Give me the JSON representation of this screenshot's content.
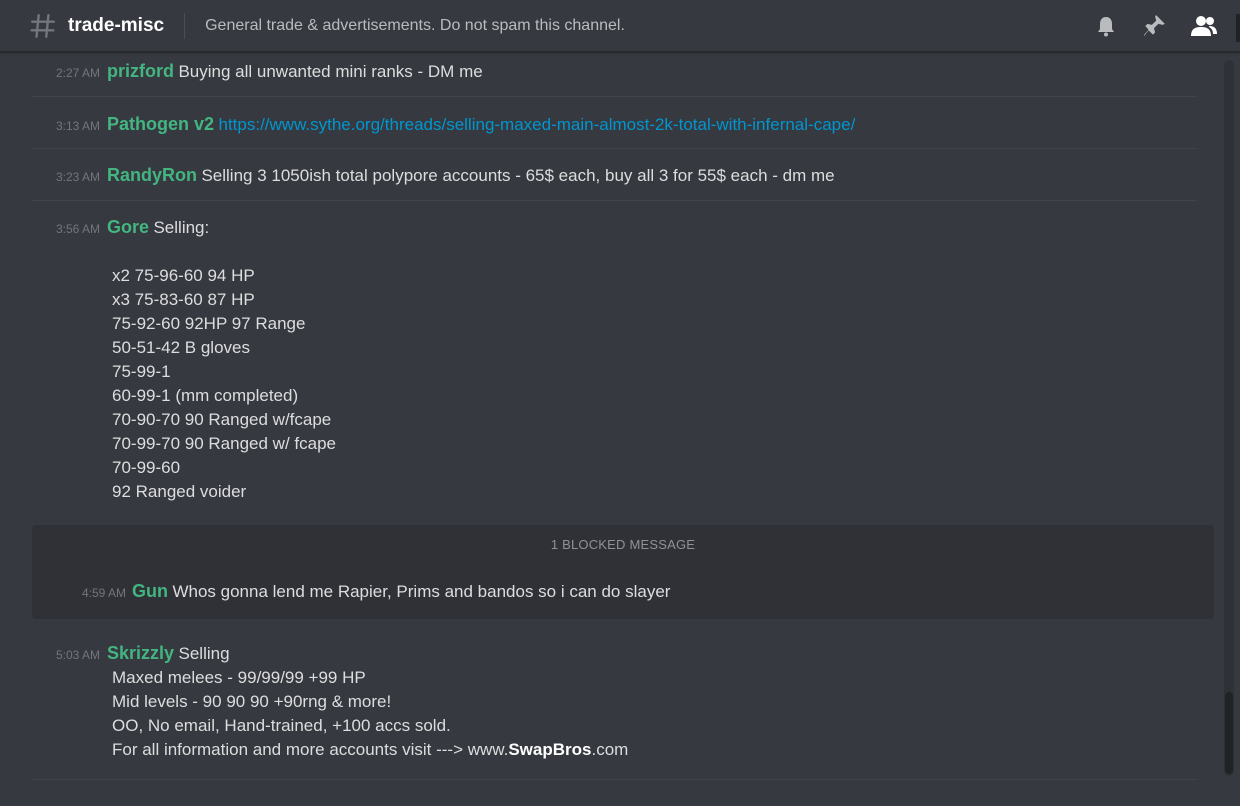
{
  "header": {
    "channel_name": "trade-misc",
    "topic": "General trade & advertisements. Do not spam this channel.",
    "icons": [
      "bell-icon",
      "pin-icon",
      "members-icon"
    ]
  },
  "messages": [
    {
      "time": "2:27 AM",
      "author": "prizford",
      "text": "Buying all unwanted mini ranks - DM me"
    },
    {
      "time": "3:13 AM",
      "author": "Pathogen v2",
      "link": "https://www.sythe.org/threads/selling-maxed-main-almost-2k-total-with-infernal-cape/"
    },
    {
      "time": "3:23 AM",
      "author": "RandyRon",
      "text": "Selling 3 1050ish total polypore accounts - 65$ each, buy all 3 for 55$ each - dm me"
    },
    {
      "time": "3:56 AM",
      "author": "Gore",
      "text": "Selling:",
      "lines": [
        "x2 75-96-60 94 HP",
        "x3 75-83-60 87 HP",
        "75-92-60 92HP 97 Range",
        "50-51-42 B gloves",
        "75-99-1",
        "60-99-1 (mm completed)",
        "70-90-70 90 Ranged w/fcape",
        "70-99-70 90 Ranged w/ fcape",
        "70-99-60",
        "92 Ranged voider"
      ]
    },
    {
      "blocked_label": "1 BLOCKED MESSAGE",
      "time": "4:59 AM",
      "author": "Gun",
      "text": "Whos gonna lend me Rapier, Prims and bandos so i can do slayer"
    },
    {
      "time": "5:03 AM",
      "author": "Skrizzly",
      "text": "Selling",
      "lines": [
        "Maxed melees - 99/99/99 +99 HP",
        "Mid levels - 90 90 90 +90rng  & more!",
        "OO, No email, Hand-trained, +100 accs sold."
      ],
      "last_prefix": "For all information and more accounts visit ---> www.",
      "last_bold": "SwapBros",
      "last_suffix": ".com"
    }
  ],
  "colors": {
    "background": "#36393f",
    "author": "#43b581",
    "link": "#0096cf",
    "timestamp": "#72767d"
  }
}
